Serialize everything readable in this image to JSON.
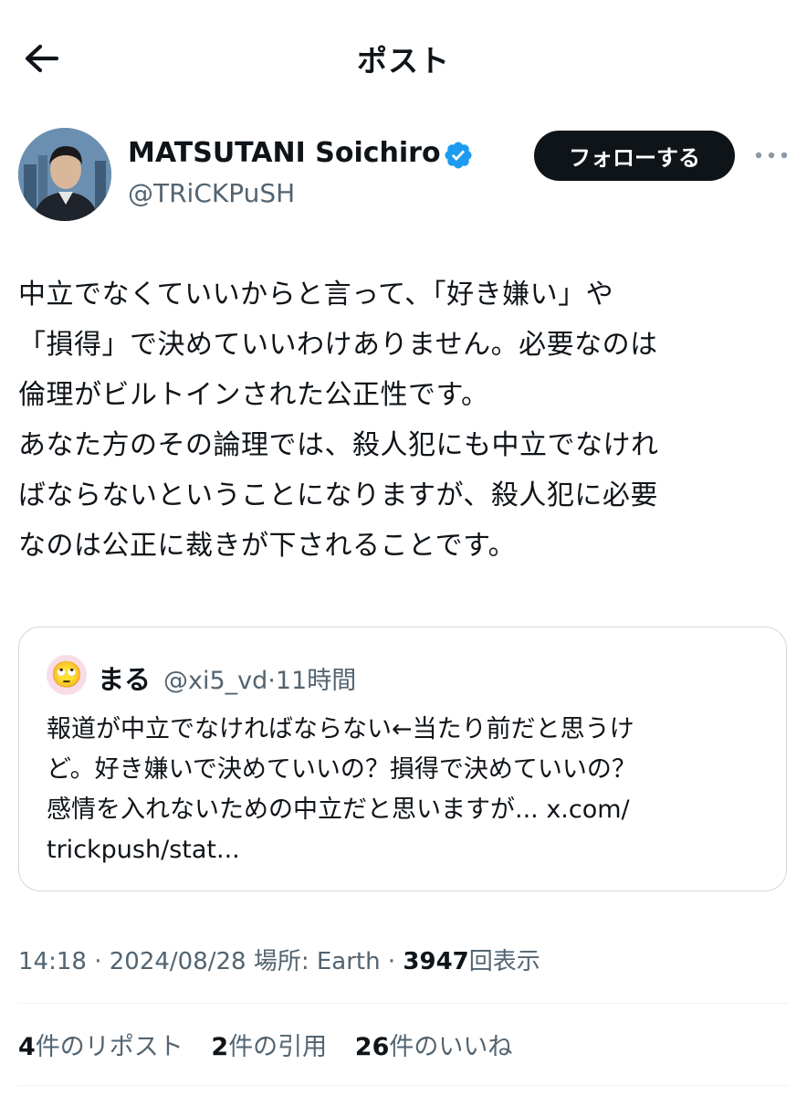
{
  "header": {
    "title": "ポスト"
  },
  "author": {
    "display_name": "MATSUTANI Soichiro",
    "handle": "@TRiCKPuSH",
    "follow_label": "フォローする",
    "verified": true,
    "verified_color": "#1d9bf0"
  },
  "tweet": {
    "text": "中立でなくていいからと言って、「好き嫌い」や\n「損得」で決めていいわけありません。必要なのは\n倫理がビルトインされた公正性です。\nあなた方のその論理では、殺人犯にも中立でなけれ\nばならないということになりますが、殺人犯に必要\nなのは公正に裁きが下されることです。"
  },
  "quote": {
    "avatar_emoji": "🙄",
    "name": "まる",
    "handle": "@xi5_vd",
    "separator": "·",
    "time": "11時間",
    "text": "報道が中立でなければならない←当たり前だと思うけ\nど。好き嫌いで決めていいの？損得で決めていいの？\n感情を入れないための中立だと思いますが... x.com/\ntrickpush/stat..."
  },
  "meta": {
    "time": "14:18",
    "sep1": " · ",
    "date": "2024/08/28",
    "location": " 場所: Earth",
    "sep2": " · ",
    "views_count": "3947",
    "views_label": "回表示"
  },
  "stats": {
    "reposts_count": "4",
    "reposts_label": "件のリポスト",
    "quotes_count": "2",
    "quotes_label": "件の引用",
    "likes_count": "26",
    "likes_label": "件のいいね"
  }
}
